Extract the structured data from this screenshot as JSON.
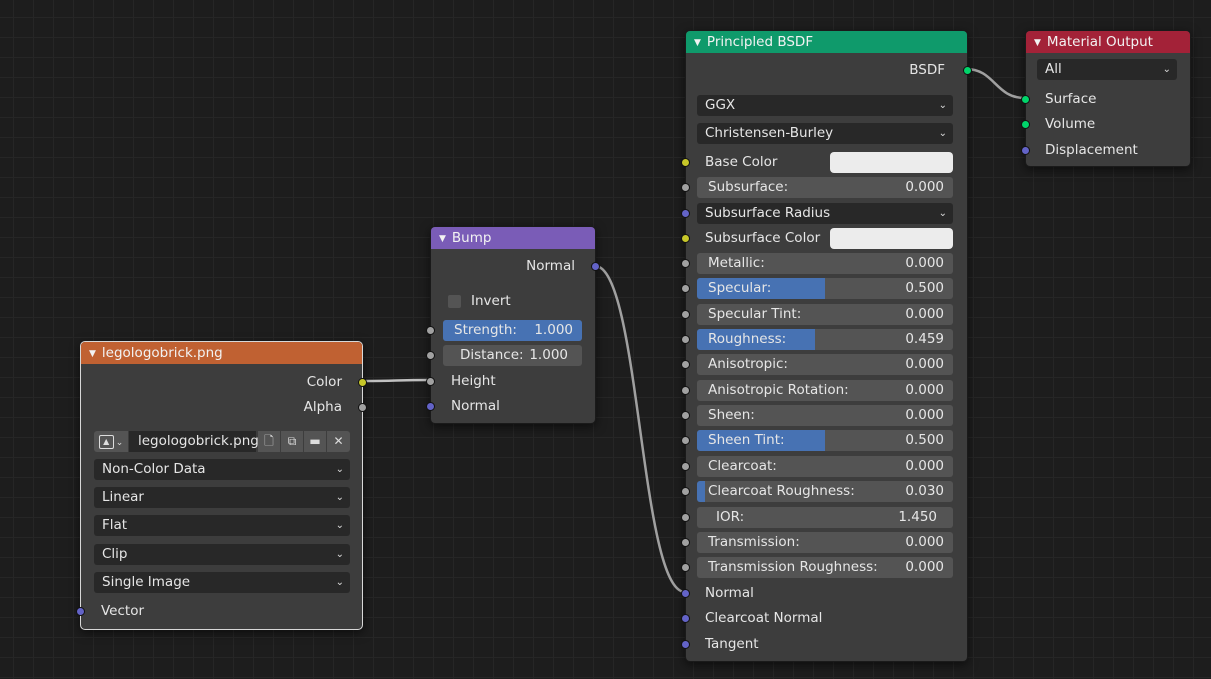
{
  "colors": {
    "image_header": "#c06132",
    "bump_header": "#7a5cb7",
    "bsdf_header": "#0f9a6b",
    "output_header": "#a32238",
    "slider_fill": "#4772b3",
    "link": "#a0a0a0"
  },
  "image_node": {
    "title": "legologobrick.png",
    "outputs": [
      "Color",
      "Alpha"
    ],
    "image_name": "legologobrick.png",
    "icons": [
      "image-type-icon",
      "chevron-down-icon",
      "new-image-icon",
      "duplicate-image-icon",
      "open-folder-icon",
      "unlink-x-icon"
    ],
    "color_space": "Non-Color Data",
    "interpolation": "Linear",
    "projection": "Flat",
    "extension": "Clip",
    "source": "Single Image",
    "input_vector": "Vector"
  },
  "bump_node": {
    "title": "Bump",
    "output_normal": "Normal",
    "invert_label": "Invert",
    "invert_checked": false,
    "strength_label": "Strength:",
    "strength_value": "1.000",
    "distance_label": "Distance:",
    "distance_value": "1.000",
    "input_height": "Height",
    "input_normal": "Normal"
  },
  "bsdf_node": {
    "title": "Principled BSDF",
    "output": "BSDF",
    "distribution": "GGX",
    "subsurface_method": "Christensen-Burley",
    "base_color_label": "Base Color",
    "subsurface_label": "Subsurface:",
    "subsurface_value": "0.000",
    "subsurface_radius_label": "Subsurface Radius",
    "subsurface_color_label": "Subsurface Color",
    "sliders": [
      {
        "label": "Metallic:",
        "value": "0.000",
        "fraction": 0.0
      },
      {
        "label": "Specular:",
        "value": "0.500",
        "fraction": 0.5
      },
      {
        "label": "Specular Tint:",
        "value": "0.000",
        "fraction": 0.0
      },
      {
        "label": "Roughness:",
        "value": "0.459",
        "fraction": 0.459
      },
      {
        "label": "Anisotropic:",
        "value": "0.000",
        "fraction": 0.0
      },
      {
        "label": "Anisotropic Rotation:",
        "value": "0.000",
        "fraction": 0.0
      },
      {
        "label": "Sheen:",
        "value": "0.000",
        "fraction": 0.0
      },
      {
        "label": "Sheen Tint:",
        "value": "0.500",
        "fraction": 0.5
      },
      {
        "label": "Clearcoat:",
        "value": "0.000",
        "fraction": 0.0
      },
      {
        "label": "Clearcoat Roughness:",
        "value": "0.030",
        "fraction": 0.03
      },
      {
        "label": "IOR:",
        "value": "1.450",
        "fraction": 0.0
      },
      {
        "label": "Transmission:",
        "value": "0.000",
        "fraction": 0.0
      },
      {
        "label": "Transmission Roughness:",
        "value": "0.000",
        "fraction": 0.0
      }
    ],
    "input_normal": "Normal",
    "input_clearcoat_normal": "Clearcoat Normal",
    "input_tangent": "Tangent"
  },
  "output_node": {
    "title": "Material Output",
    "target": "All",
    "inputs": [
      "Surface",
      "Volume",
      "Displacement"
    ]
  }
}
